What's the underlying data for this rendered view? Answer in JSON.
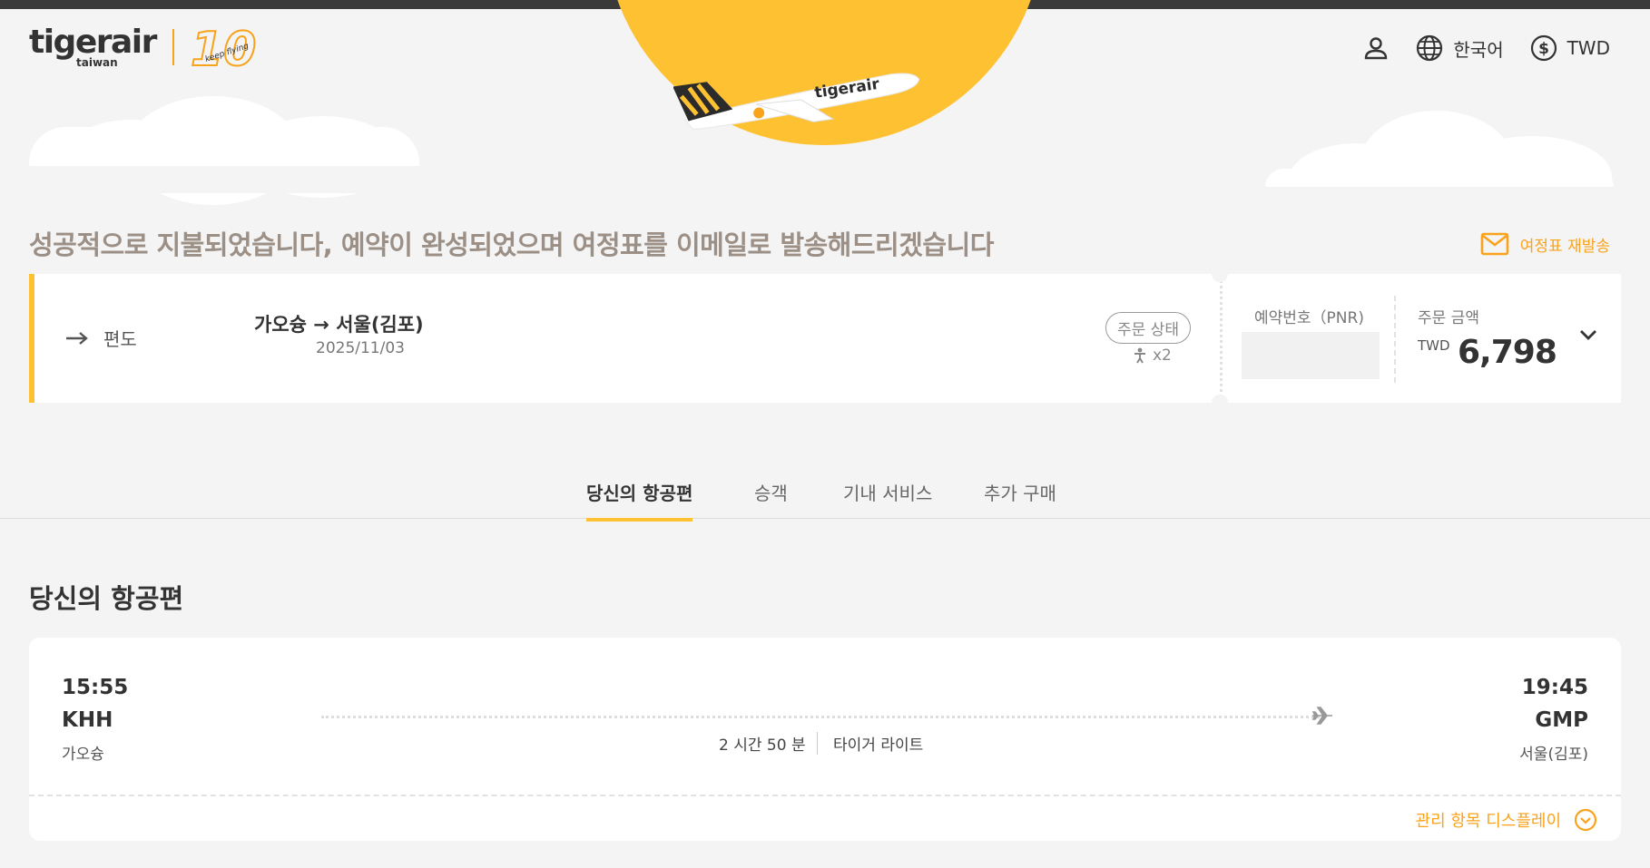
{
  "header": {
    "logo_text": "tigerair",
    "logo_sub": "taiwan",
    "anniversary": "10",
    "anniversary_tag": "keep flying",
    "plane_livery": "tigerair",
    "language_label": "한국어",
    "currency_label": "TWD",
    "icons": [
      "user-icon",
      "globe-icon",
      "dollar-icon"
    ]
  },
  "success": {
    "message": "성공적으로 지불되었습니다, 예약이 완성되었으며 여정표를 이메일로 발송해드리겠습니다",
    "resend_label": "여정표 재발송"
  },
  "booking": {
    "trip_type": "편도",
    "route": "가오슝 → 서울(김포)",
    "date": "2025/11/03",
    "status_label": "주문 상태",
    "pax_count": "x2",
    "pnr_label": "예약번호（PNR)",
    "pnr_value": "",
    "amount_label": "주문 금액",
    "amount_currency": "TWD",
    "amount_value": "6,798"
  },
  "tabs": [
    {
      "label": "당신의 항공편",
      "active": true
    },
    {
      "label": "승객",
      "active": false
    },
    {
      "label": "기내 서비스",
      "active": false
    },
    {
      "label": "추가 구매",
      "active": false
    }
  ],
  "section": {
    "title": "당신의 항공편"
  },
  "flight": {
    "dep_time": "15:55",
    "dep_code": "KHH",
    "dep_city": "가오슝",
    "arr_time": "19:45",
    "arr_code": "GMP",
    "arr_city": "서울(김포)",
    "duration": "2 시간 50 분",
    "product": "타이거 라이트",
    "manage_label": "관리 항목 디스플레이"
  },
  "colors": {
    "brand_yellow": "#fec131",
    "brand_orange": "#f9a21b",
    "title_muted": "#9b8f86",
    "background": "#f4f4f4"
  }
}
